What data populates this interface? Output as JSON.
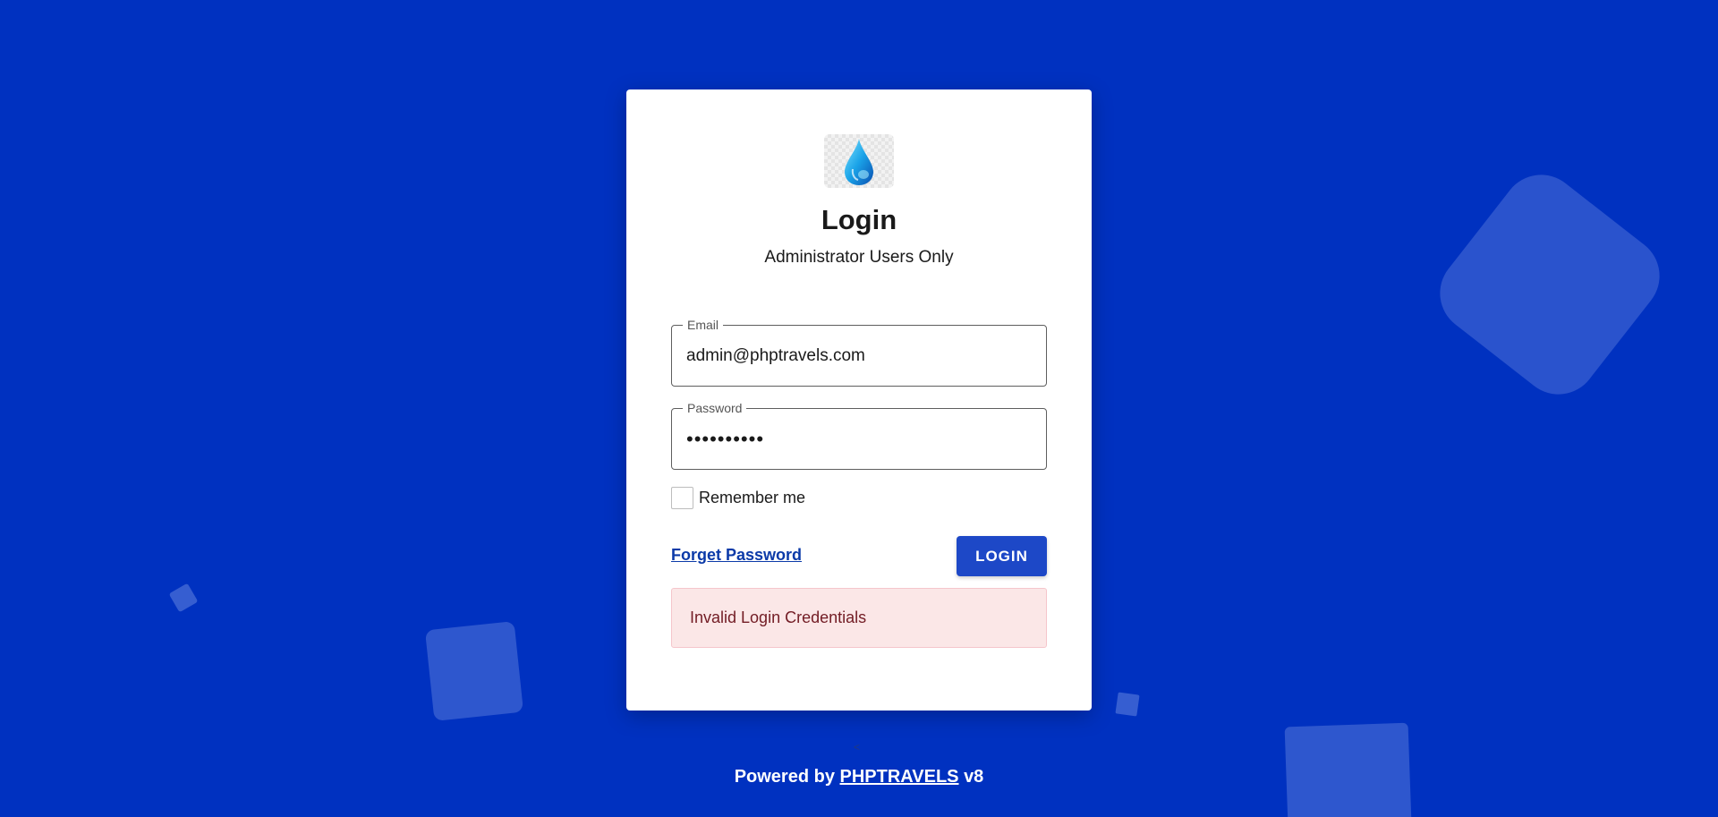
{
  "login": {
    "title": "Login",
    "subtitle": "Administrator Users Only",
    "logo_icon": "water-drop-icon"
  },
  "form": {
    "email_label": "Email",
    "email_value": "admin@phptravels.com",
    "password_label": "Password",
    "password_value": "••••••••••",
    "remember_label": "Remember me",
    "remember_checked": false,
    "forget_label": "Forget Password",
    "login_label": "LOGIN"
  },
  "alert": {
    "message": "Invalid Login Credentials"
  },
  "footer": {
    "caret": "<",
    "prefix": "Powered by",
    "brand": "PHPTRAVELS",
    "version": "v8"
  },
  "colors": {
    "background": "#0031c0",
    "primary_button": "#1d48c7",
    "alert_bg": "#fbe7e7",
    "alert_text": "#721c24"
  }
}
